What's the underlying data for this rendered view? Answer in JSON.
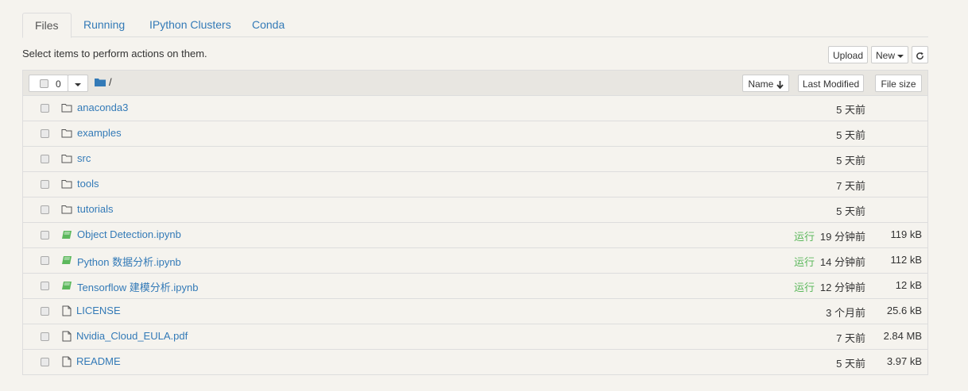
{
  "tabs": [
    "Files",
    "Running",
    "IPython Clusters",
    "Conda"
  ],
  "toolbar": {
    "select_message": "Select items to perform actions on them.",
    "upload_label": "Upload",
    "new_label": "New",
    "refresh_icon": "refresh-icon"
  },
  "list_header": {
    "selected_count": "0",
    "path": "/",
    "sort_name_label": "Name",
    "sort_modified_label": "Last Modified",
    "sort_size_label": "File size"
  },
  "items": [
    {
      "name": "anaconda3",
      "type": "folder",
      "running": "",
      "modified": "5 天前",
      "size": ""
    },
    {
      "name": "examples",
      "type": "folder",
      "running": "",
      "modified": "5 天前",
      "size": ""
    },
    {
      "name": "src",
      "type": "folder",
      "running": "",
      "modified": "5 天前",
      "size": ""
    },
    {
      "name": "tools",
      "type": "folder",
      "running": "",
      "modified": "7 天前",
      "size": ""
    },
    {
      "name": "tutorials",
      "type": "folder",
      "running": "",
      "modified": "5 天前",
      "size": ""
    },
    {
      "name": "Object Detection.ipynb",
      "type": "notebook",
      "running": "运行",
      "modified": "19 分钟前",
      "size": "119 kB"
    },
    {
      "name": "Python 数据分析.ipynb",
      "type": "notebook",
      "running": "运行",
      "modified": "14 分钟前",
      "size": "112 kB"
    },
    {
      "name": "Tensorflow 建模分析.ipynb",
      "type": "notebook",
      "running": "运行",
      "modified": "12 分钟前",
      "size": "12 kB"
    },
    {
      "name": "LICENSE",
      "type": "file",
      "running": "",
      "modified": "3 个月前",
      "size": "25.6 kB"
    },
    {
      "name": "Nvidia_Cloud_EULA.pdf",
      "type": "file",
      "running": "",
      "modified": "7 天前",
      "size": "2.84 MB"
    },
    {
      "name": "README",
      "type": "file",
      "running": "",
      "modified": "5 天前",
      "size": "3.97 kB"
    }
  ],
  "colors": {
    "link": "#337ab7",
    "running": "#5cb85c",
    "notebook_icon": "#5cb85c",
    "header_bg": "#e8e6e1",
    "page_bg": "#f5f3ee"
  }
}
